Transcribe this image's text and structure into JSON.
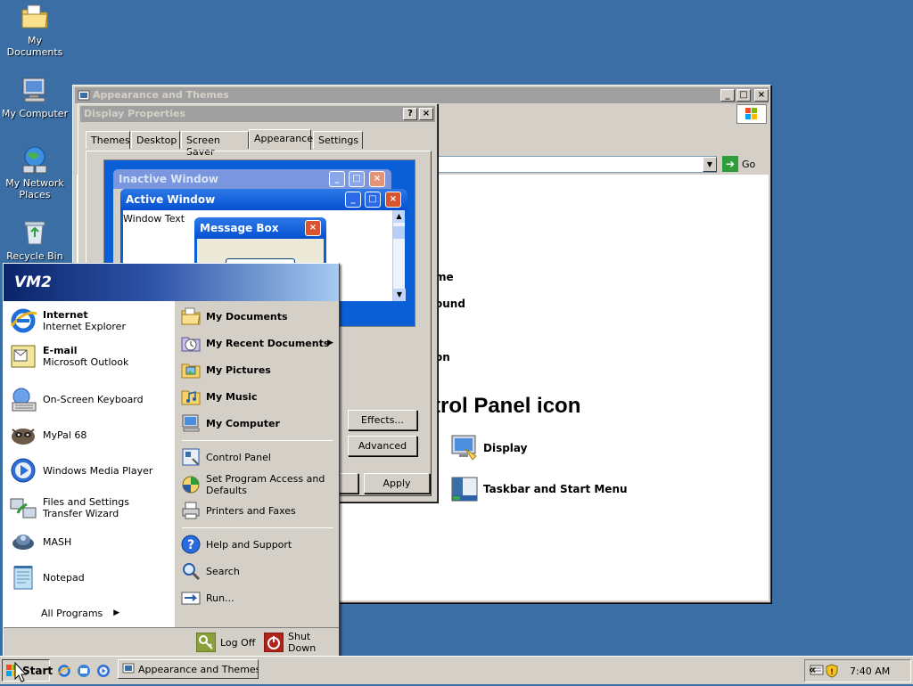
{
  "desktop": {
    "icons": [
      {
        "label": "My Documents"
      },
      {
        "label": "My Computer"
      },
      {
        "label": "My Network Places"
      },
      {
        "label": "Recycle Bin"
      }
    ]
  },
  "cp_window": {
    "title": "Appearance and Themes",
    "go_label": "Go",
    "partial_items": [
      "me",
      "ound",
      "on"
    ],
    "section_heading": "trol Panel icon",
    "icons": [
      {
        "label": "Display"
      },
      {
        "label": "Taskbar and Start Menu"
      }
    ]
  },
  "display_props": {
    "title": "Display Properties",
    "help_btn": "?",
    "close_btn": "×",
    "tabs": [
      "Themes",
      "Desktop",
      "Screen Saver",
      "Appearance",
      "Settings"
    ],
    "active_tab": "Appearance",
    "preview": {
      "inactive_window": "Inactive Window",
      "active_window": "Active Window",
      "window_text": "Window Text",
      "message_box": "Message Box"
    },
    "effects_label": "Effects...",
    "advanced_label": "Advanced",
    "apply_label": "Apply"
  },
  "start_menu": {
    "user": "VM2",
    "pinned": [
      {
        "title": "Internet",
        "subtitle": "Internet Explorer"
      },
      {
        "title": "E-mail",
        "subtitle": "Microsoft Outlook"
      }
    ],
    "recent": [
      {
        "label": "On-Screen Keyboard"
      },
      {
        "label": "MyPal 68"
      },
      {
        "label": "Windows Media Player"
      },
      {
        "label": "Files and Settings Transfer Wizard"
      },
      {
        "label": "MASH"
      },
      {
        "label": "Notepad"
      }
    ],
    "all_programs": "All Programs",
    "right_top": [
      {
        "label": "My Documents"
      },
      {
        "label": "My Recent Documents"
      },
      {
        "label": "My Pictures"
      },
      {
        "label": "My Music"
      },
      {
        "label": "My Computer"
      }
    ],
    "right_mid": [
      {
        "label": "Control Panel"
      },
      {
        "label": "Set Program Access and Defaults"
      },
      {
        "label": "Printers and Faxes"
      }
    ],
    "right_bottom": [
      {
        "label": "Help and Support"
      },
      {
        "label": "Search"
      },
      {
        "label": "Run..."
      }
    ],
    "log_off": "Log Off",
    "shut_down": "Shut Down"
  },
  "taskbar": {
    "start_label": "Start",
    "task_button": "Appearance and Themes",
    "clock": "7:40 AM",
    "tray_expand": "«"
  },
  "colors": {
    "desktop": "#3a6ea5",
    "xp_blue": "#0a5ed6",
    "xp_close": "#d9542f"
  }
}
